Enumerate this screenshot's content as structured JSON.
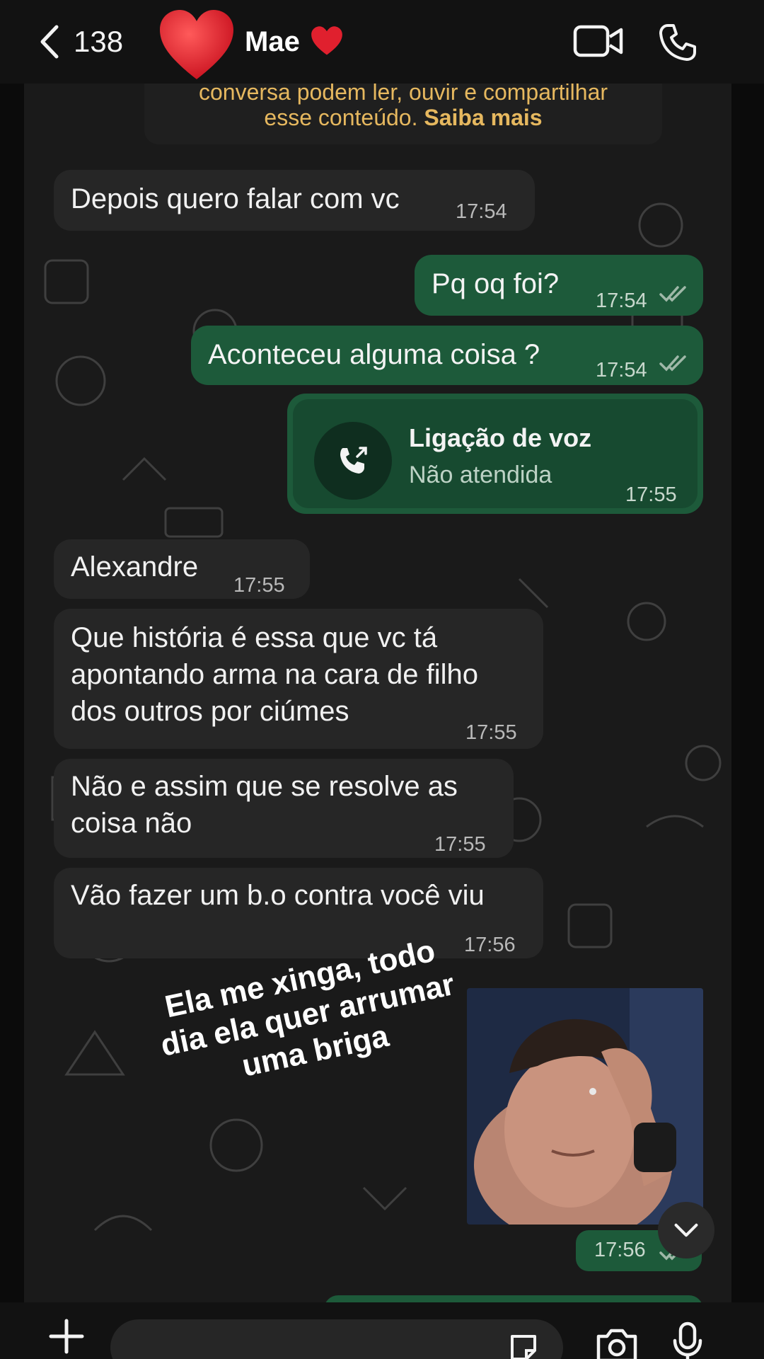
{
  "header": {
    "back_count": "138",
    "contact_name": "Mae",
    "name_emoji": "heart"
  },
  "system_note": {
    "line1": "conversa podem ler, ouvir e compartilhar",
    "line2_text": "esse conteúdo.",
    "link": "Saiba mais"
  },
  "messages": [
    {
      "dir": "in",
      "text": "Depois quero falar com vc",
      "time": "17:54"
    },
    {
      "dir": "out",
      "text": "Pq oq foi?",
      "time": "17:54",
      "status": "read"
    },
    {
      "dir": "out",
      "text": "Aconteceu alguma coisa ?",
      "time": "17:54",
      "status": "read"
    },
    {
      "dir": "out",
      "type": "call",
      "title": "Ligação de voz",
      "subtitle": "Não atendida",
      "time": "17:55"
    },
    {
      "dir": "in",
      "text": "Alexandre",
      "time": "17:55"
    },
    {
      "dir": "in",
      "lines": [
        "Que história é essa que vc tá",
        "apontando arma na cara de filho",
        "dos outros por ciúmes"
      ],
      "time": "17:55"
    },
    {
      "dir": "in",
      "lines": [
        "Não e assim que se resolve as",
        "coisa não"
      ],
      "time": "17:55"
    },
    {
      "dir": "in",
      "text": "Vão fazer um b.o contra você viu",
      "time": "17:56"
    },
    {
      "dir": "out",
      "type": "image",
      "time": "17:56"
    }
  ],
  "overlay": {
    "lines": [
      "Ela me xinga, todo",
      "dia ela quer arrumar",
      "uma briga"
    ]
  },
  "colors": {
    "outgoing_bubble": "#1d5a3a",
    "incoming_bubble": "#262626",
    "system_text": "#e6b85f",
    "read_ticks": "#9fb8a8"
  },
  "icons": [
    "chevron-left-icon",
    "video-call-icon",
    "phone-icon",
    "call-missed-icon",
    "chevron-down-icon",
    "plus-icon",
    "sticker-icon",
    "camera-icon",
    "mic-icon"
  ]
}
